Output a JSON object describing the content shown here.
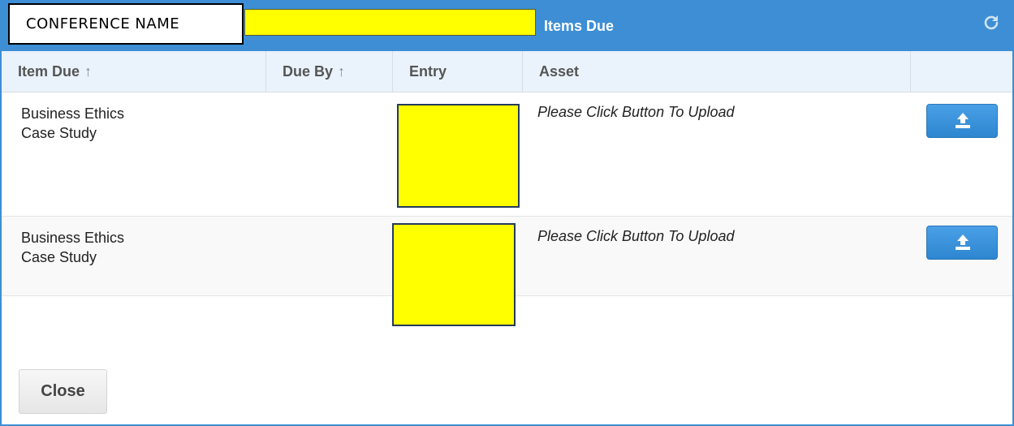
{
  "conference": {
    "name": "CONFERENCE NAME"
  },
  "dialog": {
    "title": "Items Due",
    "refresh_icon": "refresh-icon"
  },
  "table": {
    "columns": {
      "item_due": "Item Due",
      "due_by": "Due By",
      "entry": "Entry",
      "asset": "Asset",
      "sort_icon": "↑"
    },
    "rows": [
      {
        "item_line1": "Business Ethics",
        "item_line2": "Case Study",
        "asset": "Please Click Button To Upload",
        "action_icon": "upload-icon"
      },
      {
        "item_line1": "Business Ethics",
        "item_line2": "Case Study",
        "asset": "Please Click Button To Upload",
        "action_icon": "upload-icon"
      }
    ]
  },
  "footer": {
    "close_label": "Close"
  },
  "colors": {
    "header": "#3d8ed4",
    "redaction": "#ffff00",
    "button": "#2d86d0"
  }
}
